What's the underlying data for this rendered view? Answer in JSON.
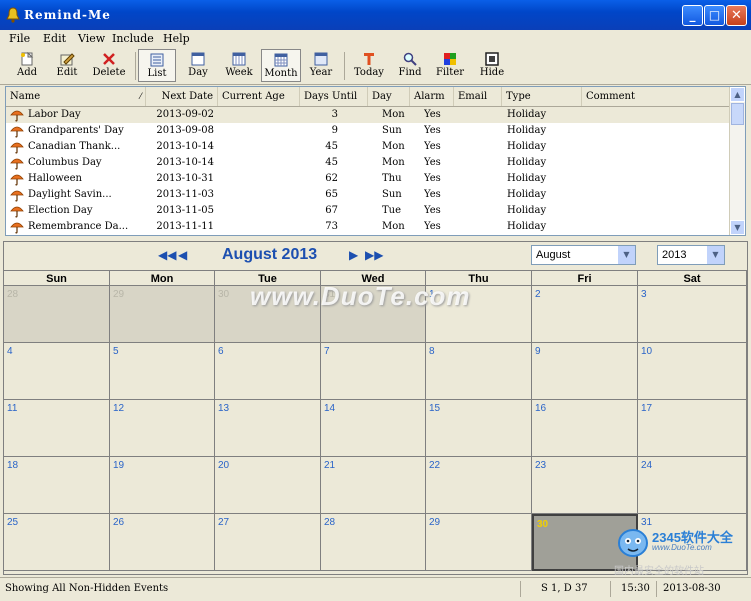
{
  "window": {
    "title": "Remind-Me"
  },
  "menu": [
    "File",
    "Edit",
    "View",
    "Include",
    "Help"
  ],
  "toolbar": {
    "add": "Add",
    "edit": "Edit",
    "delete": "Delete",
    "list": "List",
    "day": "Day",
    "week": "Week",
    "month": "Month",
    "year": "Year",
    "today": "Today",
    "find": "Find",
    "filter": "Filter",
    "hide": "Hide"
  },
  "list": {
    "columns": [
      "Name",
      "Next Date",
      "Current Age",
      "Days Until",
      "Day",
      "Alarm",
      "Email",
      "Type",
      "Comment"
    ],
    "rows": [
      {
        "name": "Labor Day",
        "date": "2013-09-02",
        "until": "3",
        "day": "Mon",
        "alarm": "Yes",
        "type": "Holiday"
      },
      {
        "name": "Grandparents' Day",
        "date": "2013-09-08",
        "until": "9",
        "day": "Sun",
        "alarm": "Yes",
        "type": "Holiday"
      },
      {
        "name": "Canadian Thank...",
        "date": "2013-10-14",
        "until": "45",
        "day": "Mon",
        "alarm": "Yes",
        "type": "Holiday"
      },
      {
        "name": "Columbus Day",
        "date": "2013-10-14",
        "until": "45",
        "day": "Mon",
        "alarm": "Yes",
        "type": "Holiday"
      },
      {
        "name": "Halloween",
        "date": "2013-10-31",
        "until": "62",
        "day": "Thu",
        "alarm": "Yes",
        "type": "Holiday"
      },
      {
        "name": "Daylight Savin...",
        "date": "2013-11-03",
        "until": "65",
        "day": "Sun",
        "alarm": "Yes",
        "type": "Holiday"
      },
      {
        "name": "Election Day",
        "date": "2013-11-05",
        "until": "67",
        "day": "Tue",
        "alarm": "Yes",
        "type": "Holiday"
      },
      {
        "name": "Remembrance Da...",
        "date": "2013-11-11",
        "until": "73",
        "day": "Mon",
        "alarm": "Yes",
        "type": "Holiday"
      }
    ]
  },
  "calendar": {
    "title": "August 2013",
    "month_select": "August",
    "year_select": "2013",
    "nav": {
      "prev_year": "◀◀",
      "prev": "◀",
      "next": "▶",
      "next_year": "▶▶"
    },
    "weekdays": [
      "Sun",
      "Mon",
      "Tue",
      "Wed",
      "Thu",
      "Fri",
      "Sat"
    ],
    "weeks": [
      [
        "28",
        "29",
        "30",
        "31",
        "1",
        "2",
        "3"
      ],
      [
        "4",
        "5",
        "6",
        "7",
        "8",
        "9",
        "10"
      ],
      [
        "11",
        "12",
        "13",
        "14",
        "15",
        "16",
        "17"
      ],
      [
        "18",
        "19",
        "20",
        "21",
        "22",
        "23",
        "24"
      ],
      [
        "25",
        "26",
        "27",
        "28",
        "29",
        "30",
        "31"
      ]
    ],
    "today": "30"
  },
  "watermark": "www.DuoTe.com",
  "status": {
    "message": "Showing All Non-Hidden Events",
    "counts": "S 1, D 37",
    "time": "15:30",
    "date": "2013-08-30"
  },
  "logo": {
    "brand": "2345软件大全",
    "url": "www.DuoTe.com",
    "slogan": "国内最安全的软件站"
  },
  "colors": {
    "accent": "#1c4fb0",
    "day_number": "#2a64c8",
    "today_number": "#f0d000"
  }
}
